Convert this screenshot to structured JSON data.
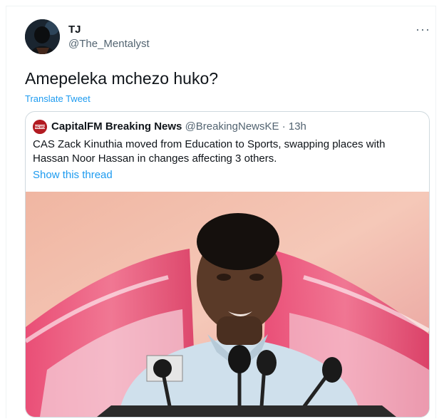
{
  "tweet": {
    "display_name": "TJ",
    "handle": "@The_Mentalyst",
    "more_glyph": "···",
    "text": "Amepeleka mchezo huko?",
    "translate_label": "Translate Tweet"
  },
  "quoted": {
    "display_name": "CapitalFM Breaking News",
    "handle": "@BreakingNewsKE",
    "separator": "·",
    "time": "13h",
    "text": "CAS Zack Kinuthia moved from Education to Sports, swapping places with Hassan Noor Hassan in changes affecting 3 others.",
    "show_thread_label": "Show this thread",
    "avatar_badge": "NEWS"
  },
  "colors": {
    "link": "#1d9bf0",
    "secondary_text": "#536471",
    "primary_text": "#0f1419",
    "border": "#cfd9de"
  }
}
